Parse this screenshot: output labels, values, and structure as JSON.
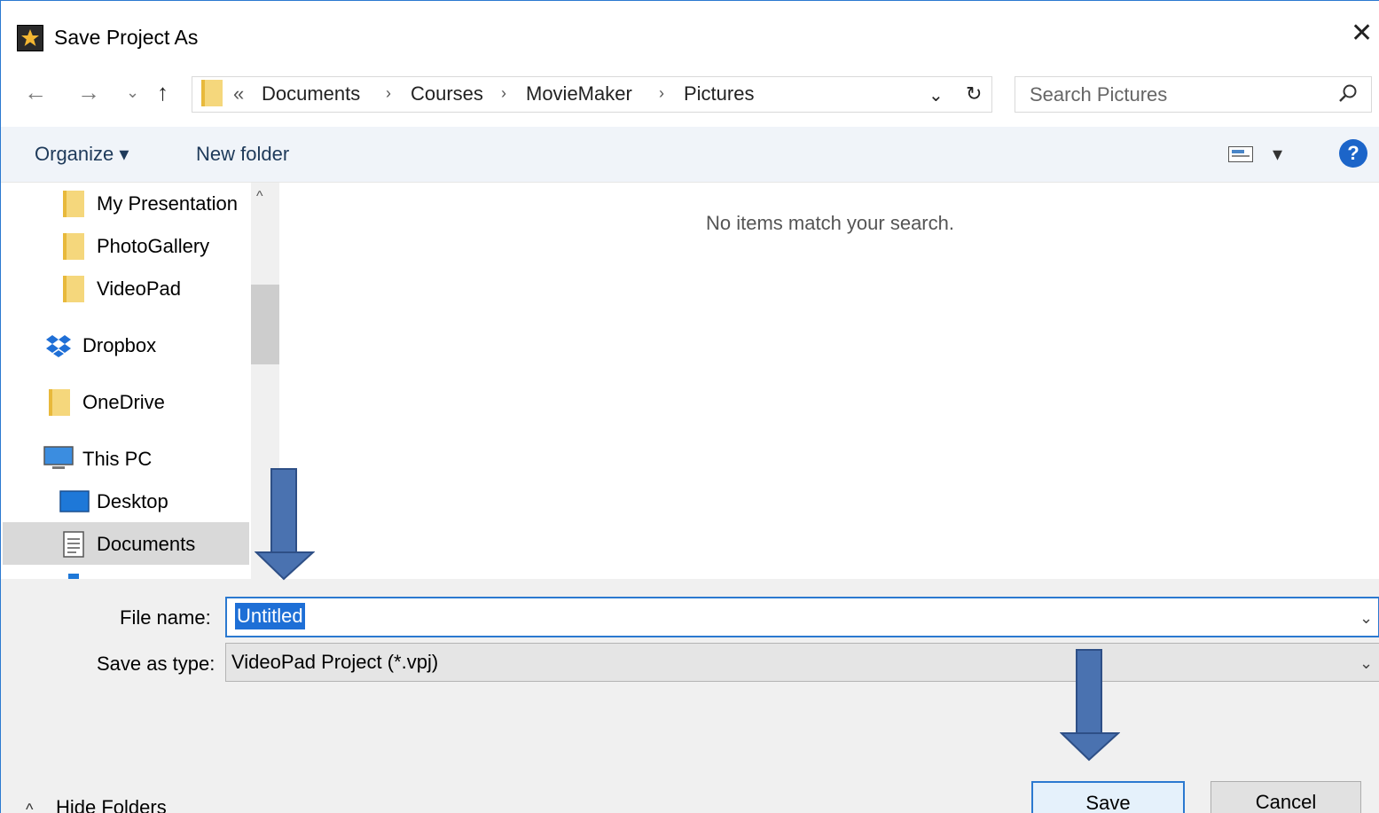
{
  "window": {
    "title": "Save Project As",
    "icon": "app-star-icon",
    "close": "✕"
  },
  "nav": {
    "back": "←",
    "forward": "→",
    "recent": "⌄",
    "up": "↑",
    "overflow": "«",
    "breadcrumbs": [
      "Documents",
      "Courses",
      "MovieMaker",
      "Pictures"
    ],
    "separator": "›",
    "dropdown": "⌄",
    "refresh": "↻"
  },
  "search": {
    "placeholder": "Search Pictures",
    "icon": "search-icon"
  },
  "toolbar": {
    "organize": "Organize ▾",
    "new_folder": "New folder",
    "view_dropdown": "▾",
    "help": "?"
  },
  "sidebar": {
    "items": [
      {
        "label": "My Presentation",
        "icon": "folder-icon"
      },
      {
        "label": "PhotoGallery",
        "icon": "folder-icon"
      },
      {
        "label": "VideoPad",
        "icon": "folder-icon"
      },
      {
        "label": "Dropbox",
        "icon": "dropbox-icon"
      },
      {
        "label": "OneDrive",
        "icon": "folder-icon"
      },
      {
        "label": "This PC",
        "icon": "computer-icon"
      },
      {
        "label": "Desktop",
        "icon": "desktop-icon"
      },
      {
        "label": "Documents",
        "icon": "documents-icon",
        "selected": true
      }
    ]
  },
  "main": {
    "empty_message": "No items match your search."
  },
  "form": {
    "file_name_label": "File name:",
    "file_name_value": "Untitled",
    "save_as_type_label": "Save as type:",
    "save_as_type_value": "VideoPad Project (*.vpj)"
  },
  "footer": {
    "hide_folders": "Hide Folders",
    "hide_folders_icon": "^",
    "save": "Save",
    "cancel": "Cancel"
  },
  "colors": {
    "accent": "#2b79d0",
    "toolbar_bg": "#f0f4f9",
    "annotation_arrow": "#4a72b0",
    "selection": "#1e6fd6"
  }
}
